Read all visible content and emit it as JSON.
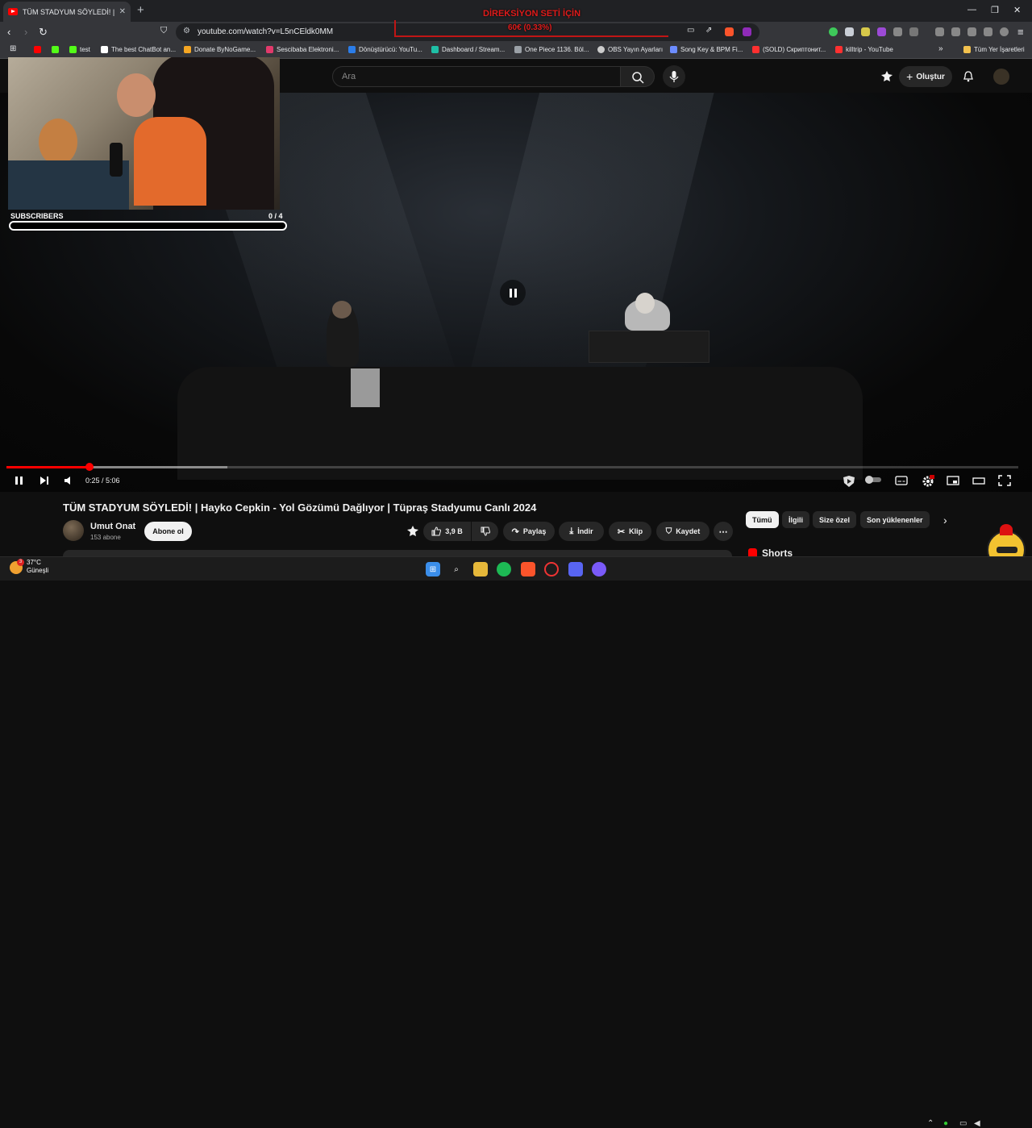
{
  "browser": {
    "tab_title": "TÜM STADYUM SÖYLEDİ! | H",
    "url": "youtube.com/watch?v=L5nCEldk0MM",
    "bookmarks": [
      {
        "label": "test",
        "color": "#53fc18"
      },
      {
        "label": "The best ChatBot an...",
        "color": "#ffffff"
      },
      {
        "label": "Donate ByNoGame...",
        "color": "#f5a623"
      },
      {
        "label": "Sescibaba Elektroni...",
        "color": "#e23a6b"
      },
      {
        "label": "Dönüştürücü: YouTu...",
        "color": "#2b7de9"
      },
      {
        "label": "Dashboard / Stream...",
        "color": "#1fbfa6"
      },
      {
        "label": "One Piece 1136. Böl...",
        "color": "#9aa0a6"
      },
      {
        "label": "OBS Yayın Ayarları",
        "color": "#cccccc"
      },
      {
        "label": "Song Key & BPM Fi...",
        "color": "#6c8cff"
      },
      {
        "label": "(SOLD) Скриптонит...",
        "color": "#ff3030"
      },
      {
        "label": "killtrip - YouTube",
        "color": "#ff3030"
      }
    ],
    "all_bookmarks": "Tüm Yer İşaretleri"
  },
  "overlay": {
    "goal_title": "DİREKSİYON SETİ İÇİN",
    "goal_progress": "60€ (0.33%)"
  },
  "youtube": {
    "search_placeholder": "Ara",
    "create_label": "Oluştur"
  },
  "stream_widget": {
    "label": "SUBSCRIBERS",
    "count": "0",
    "goal": "/ 4",
    "progress": 0
  },
  "player": {
    "time": "0:25 / 5:06",
    "played_fraction": 0.082,
    "buffered_fraction": 0.218
  },
  "video": {
    "title": "TÜM STADYUM SÖYLEDİ! | Hayko Cepkin - Yol Gözümü Dağlıyor | Tüpraş Stadyumu Canlı 2024",
    "channel": "Umut Onat",
    "subscribers": "153 abone",
    "subscribe_label": "Abone ol",
    "likes": "3,9 B",
    "share_label": "Paylaş",
    "download_label": "İndir",
    "clip_label": "Klip",
    "save_label": "Kaydet"
  },
  "sidebar": {
    "chips": [
      "Tümü",
      "İlgili",
      "Size özel",
      "Son yüklenenler"
    ],
    "shorts_label": "Shorts"
  },
  "taskbar": {
    "temperature": "37°C",
    "weather": "Güneşli",
    "badge": "3"
  },
  "colors": {
    "youtube_red": "#ff0000",
    "overlay_red": "#e01b1b",
    "background": "#0f0f0f"
  }
}
